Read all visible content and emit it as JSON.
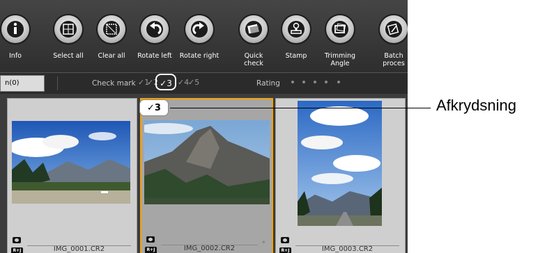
{
  "toolbar": {
    "buttons": [
      {
        "label": "Info",
        "icon": "info-icon"
      },
      {
        "label": "Select all",
        "icon": "select-all-icon"
      },
      {
        "label": "Clear all",
        "icon": "clear-all-icon"
      },
      {
        "label": "Rotate left",
        "icon": "rotate-left-icon"
      },
      {
        "label": "Rotate right",
        "icon": "rotate-right-icon"
      },
      {
        "label": "Quick\ncheck",
        "icon": "quick-check-icon"
      },
      {
        "label": "Stamp",
        "icon": "stamp-icon"
      },
      {
        "label": "Trimming\nAngle",
        "icon": "trimming-angle-icon"
      },
      {
        "label": "Batch\nproces",
        "icon": "batch-process-icon"
      }
    ]
  },
  "filterbar": {
    "selection_text": "n(0)",
    "check_mark_label": "Check mark",
    "check_marks": [
      "✓1",
      "✓2",
      "✓3",
      "✓4",
      "✓5"
    ],
    "rating_label": "Rating"
  },
  "thumbnails": [
    {
      "filename": "IMG_0001.CR2",
      "badge": "R+J",
      "selected": false
    },
    {
      "filename": "IMG_0002.CR2",
      "badge": "R+J",
      "selected": true,
      "check_mark": "✓3",
      "extra": "*"
    },
    {
      "filename": "IMG_0003.CR2",
      "badge": "R+J",
      "selected": false
    }
  ],
  "callout": {
    "text": "Afkrydsning"
  },
  "colors": {
    "selection_border": "#f2a20c",
    "toolbar_bg": "#3a3a3a"
  }
}
